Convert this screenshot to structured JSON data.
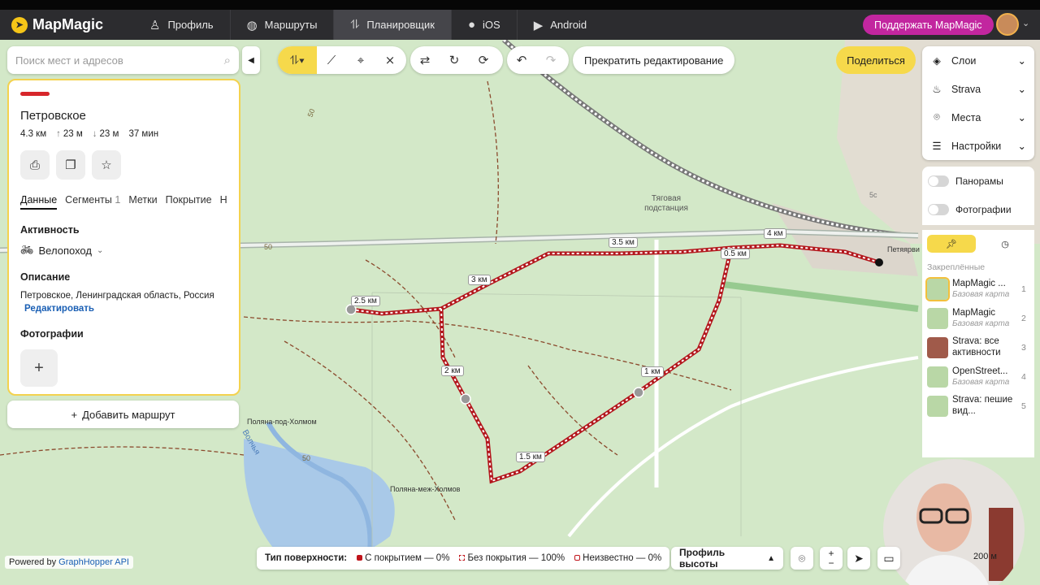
{
  "nav": {
    "logo": "MapMagic",
    "items": [
      {
        "label": "Профиль",
        "icon": "person-icon"
      },
      {
        "label": "Маршруты",
        "icon": "globe-icon"
      },
      {
        "label": "Планировщик",
        "icon": "route-icon"
      },
      {
        "label": "iOS",
        "icon": "apple-icon"
      },
      {
        "label": "Android",
        "icon": "play-icon"
      }
    ],
    "support": "Поддержать MapMagic"
  },
  "search": {
    "placeholder": "Поиск мест и адресов"
  },
  "panel": {
    "route_color": "#d7262b",
    "title": "Петровское",
    "distance": "4.3 км",
    "ascent": "23 м",
    "descent": "23 м",
    "duration": "37 мин",
    "tabs": [
      "Данные",
      "Сегменты",
      "Метки",
      "Покрытие",
      "На"
    ],
    "segments_count": "1",
    "activity_heading": "Активность",
    "activity": "Велопоход",
    "description_heading": "Описание",
    "description": "Петровское, Ленинградская область, Россия",
    "edit_link": "Редактировать",
    "photos_heading": "Фотографии"
  },
  "add_route": "Добавить маршрут",
  "toolbar": {
    "stop_edit": "Прекратить редактирование",
    "share": "Поделиться"
  },
  "right_menu": [
    {
      "label": "Слои",
      "icon": "layers-icon"
    },
    {
      "label": "Strava",
      "icon": "strava-icon"
    },
    {
      "label": "Места",
      "icon": "pin-icon"
    },
    {
      "label": "Настройки",
      "icon": "sliders-icon"
    }
  ],
  "toggles": [
    "Панорамы",
    "Фотографии"
  ],
  "layers": {
    "pinned_label": "Закреплённые",
    "items": [
      {
        "name": "MapMagic ...",
        "sub": "Базовая карта",
        "num": "1"
      },
      {
        "name": "MapMagic",
        "sub": "Базовая карта",
        "num": "2"
      },
      {
        "name": "Strava: все активности",
        "sub": "",
        "num": "3"
      },
      {
        "name": "OpenStreet...",
        "sub": "Базовая карта",
        "num": "4"
      },
      {
        "name": "Strava: пешие вид...",
        "sub": "",
        "num": "5"
      }
    ]
  },
  "map_labels": {
    "markers": [
      "4 км",
      "3.5 км",
      "0.5 км",
      "3 км",
      "2.5 км",
      "2 км",
      "1 км",
      "1.5 км"
    ],
    "places": [
      "Тяговая подстанция",
      "Поляна-под-Холмом",
      "Поляна-меж-Холмов",
      "Петяярви",
      "Волчья"
    ],
    "contours": [
      "50",
      "50",
      "50",
      "5с"
    ]
  },
  "bottom": {
    "powered_prefix": "Powered by ",
    "powered_link": "GraphHopper API",
    "surface_label": "Тип поверхности:",
    "surface_paved": "С покрытием — 0%",
    "surface_unpaved": "Без покрытия — 100%",
    "surface_unknown": "Неизвестно — 0%",
    "elevation": "Профиль высоты",
    "scale": "200 м"
  }
}
